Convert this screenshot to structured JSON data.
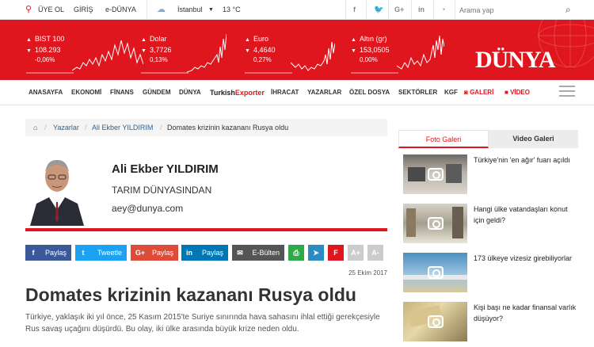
{
  "topbar": {
    "register": "ÜYE OL",
    "login": "GİRİŞ",
    "edunya": "e-DÜNYA",
    "city": "İstanbul",
    "temperature": "13 °C",
    "search_placeholder": "Arama yap"
  },
  "markets": [
    {
      "label": "BIST 100",
      "value": "108.293",
      "change": "-0,06%",
      "direction": "down"
    },
    {
      "label": "Dolar",
      "value": "3,7726",
      "change": "0,13%",
      "direction": "up"
    },
    {
      "label": "Euro",
      "value": "4,4640",
      "change": "0,27%",
      "direction": "up"
    },
    {
      "label": "Altın (gr)",
      "value": "153,0505",
      "change": "0,00%",
      "direction": "up"
    }
  ],
  "logo": "DÜNYA",
  "nav": {
    "items": [
      "ANASAYFA",
      "EKONOMİ",
      "FİNANS",
      "GÜNDEM",
      "DÜNYA"
    ],
    "turkish": "Turkish",
    "exporter": "Exporter",
    "items2": [
      "İHRACAT",
      "YAZARLAR",
      "ÖZEL DOSYA",
      "SEKTÖRLER",
      "KGF"
    ],
    "gallery": "GALERİ",
    "video": "VİDEO"
  },
  "breadcrumb": {
    "home_icon": "home-icon",
    "items": [
      "Yazarlar",
      "Ali Ekber YILDIRIM",
      "Domates krizinin kazananı Rusya oldu"
    ]
  },
  "author": {
    "name": "Ali Ekber YILDIRIM",
    "column": "TARIM DÜNYASINDAN",
    "email": "aey@dunya.com"
  },
  "share": {
    "facebook": "Paylaş",
    "twitter": "Tweetle",
    "googleplus": "Paylaş",
    "linkedin": "Paylaş",
    "ebulten": "E-Bülten",
    "font_up": "A+",
    "font_down": "A-"
  },
  "article": {
    "date": "25 Ekim 2017",
    "title": "Domates krizinin kazananı Rusya oldu",
    "intro": "Türkiye, yaklaşık iki yıl önce, 25 Kasım 2015'te Suriye sınırında hava sahasını ihlal ettiği gerekçesiyle Rus savaş uçağını düşürdü. Bu olay, iki ülke arasında büyük krize neden oldu."
  },
  "gallery": {
    "tab_photo": "Foto Galeri",
    "tab_video": "Video Galeri",
    "items": [
      {
        "caption": "Türkiye'nin 'en ağır' fuarı açıldı"
      },
      {
        "caption": "Hangi ülke vatandaşları konut için geldi?"
      },
      {
        "caption": "173 ülkeye vizesiz girebiliyorlar"
      },
      {
        "caption": "Kişi başı ne kadar finansal varlık düşüyor?"
      }
    ]
  },
  "colors": {
    "brand": "#e0161e",
    "facebook": "#3b5998",
    "twitter": "#1da1f2",
    "googleplus": "#dd4b39",
    "linkedin": "#0077b5",
    "ebulten": "#555555"
  }
}
